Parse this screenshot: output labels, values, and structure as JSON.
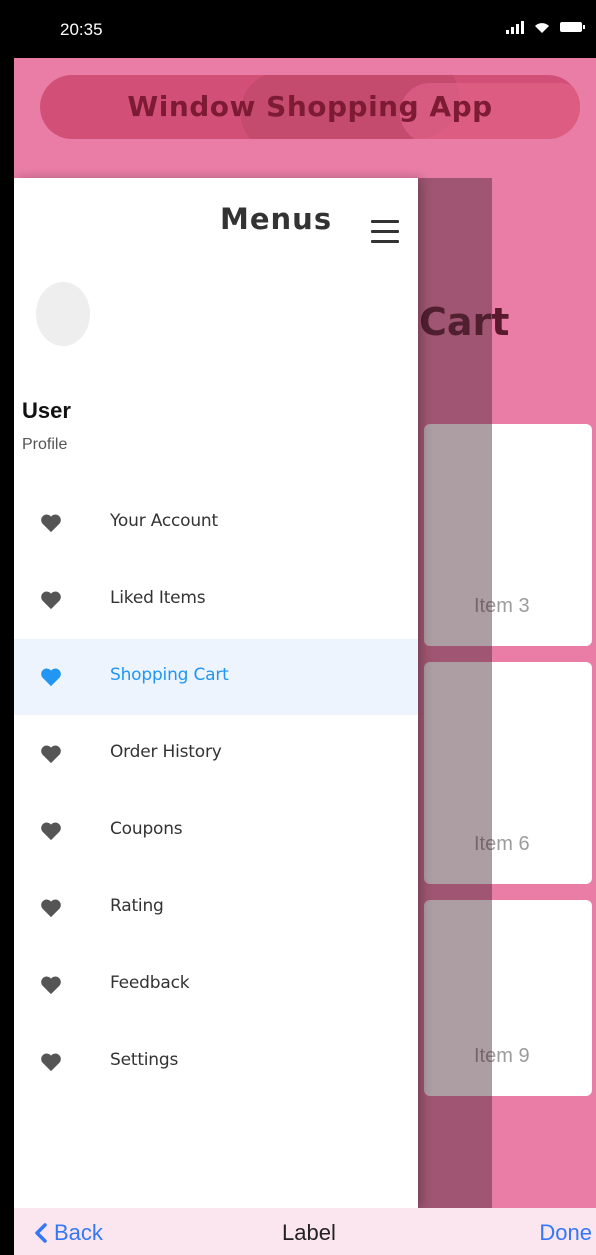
{
  "status": {
    "time": "20:35"
  },
  "app": {
    "title": "Window Shopping App"
  },
  "page": {
    "heading": "Cart",
    "items": [
      "Item 3",
      "Item 6",
      "Item 9"
    ]
  },
  "drawer": {
    "title": "Menus",
    "user": {
      "name": "User",
      "subtitle": "Profile"
    },
    "items": [
      {
        "label": "Your Account",
        "icon": "heart-icon"
      },
      {
        "label": "Liked Items",
        "icon": "heart-icon"
      },
      {
        "label": "Shopping Cart",
        "icon": "heart-icon",
        "active": true
      },
      {
        "label": "Order History",
        "icon": "heart-icon"
      },
      {
        "label": "Coupons",
        "icon": "heart-icon"
      },
      {
        "label": "Rating",
        "icon": "heart-icon"
      },
      {
        "label": "Feedback",
        "icon": "heart-icon"
      },
      {
        "label": "Settings",
        "icon": "heart-icon"
      }
    ]
  },
  "bottombar": {
    "back": "Back",
    "label": "Label",
    "done": "Done"
  },
  "colors": {
    "accent": "#2196f3",
    "brand_pink": "#ea7da6",
    "title_pill": "#d25077",
    "ios_blue": "#3478f6"
  }
}
